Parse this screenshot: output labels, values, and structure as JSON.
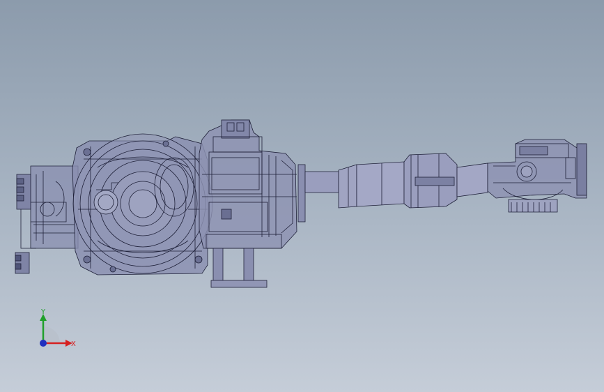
{
  "viewport": {
    "background_top": "#8c9bac",
    "background_bottom": "#c5cdd8",
    "model_fill": "#8a8fb0",
    "model_stroke": "#1e2038"
  },
  "triad": {
    "x_label": "X",
    "y_label": "Y",
    "x_color": "#d62020",
    "y_color": "#1fa02a",
    "z_color": "#2030c0"
  }
}
